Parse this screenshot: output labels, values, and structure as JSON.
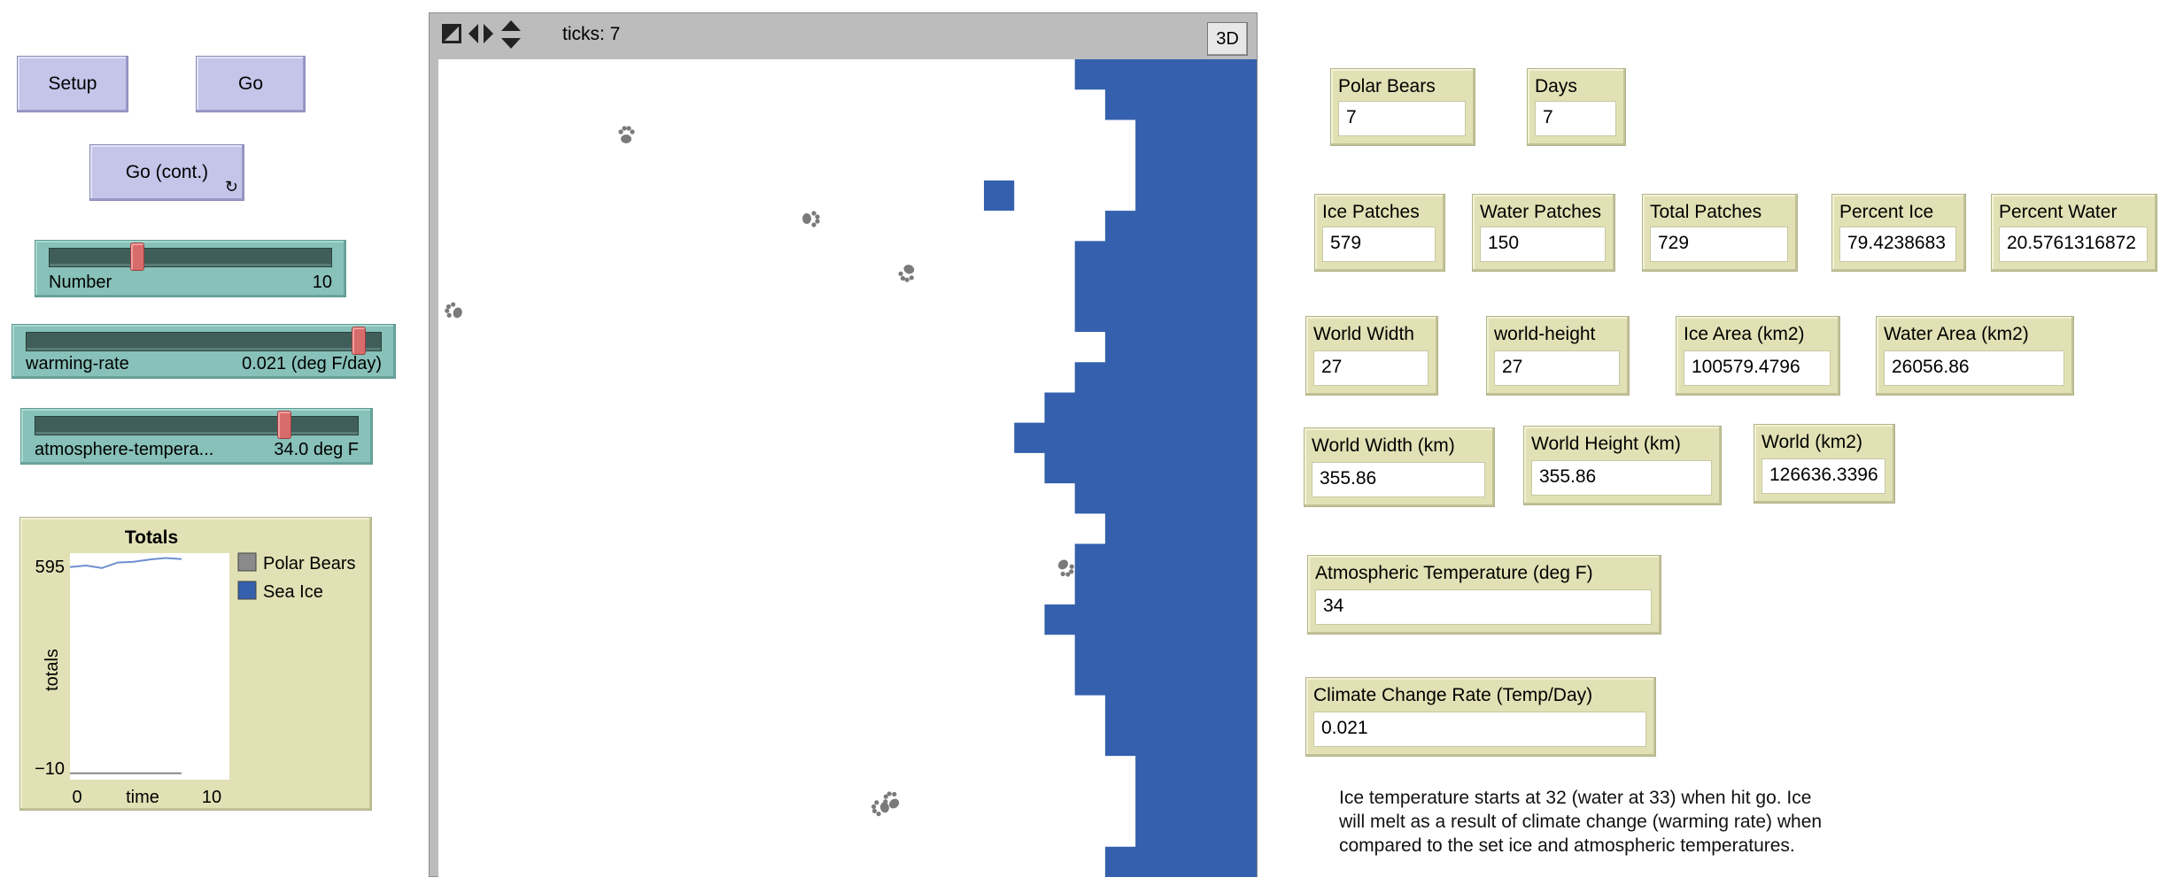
{
  "buttons": {
    "setup": "Setup",
    "go": "Go",
    "go_cont": "Go (cont.)"
  },
  "sliders": {
    "number": {
      "label": "Number",
      "value": "10",
      "fraction": 0.3
    },
    "warming_rate": {
      "label": "warming-rate",
      "value": "0.021 (deg F/day)",
      "fraction": 0.95
    },
    "atmosphere_temperature": {
      "label": "atmosphere-tempera...",
      "value": "34.0 deg F",
      "fraction": 0.78
    }
  },
  "view": {
    "ticks": "ticks: 7",
    "btn_3d": "3D",
    "colors": {
      "ice": "#ffffff",
      "water": "#3460ad",
      "bear": "#7a7a7a",
      "frame": "#bcbcbc"
    }
  },
  "plot": {
    "title": "Totals",
    "ylabel": "totals",
    "xlabel": "time",
    "ymax_label": "595",
    "ymin_label": "−10",
    "xmin_label": "0",
    "xmax_label": "10",
    "legend": [
      {
        "name": "Polar Bears",
        "color": "#8a8a8a"
      },
      {
        "name": "Sea Ice",
        "color": "#3460ad"
      }
    ]
  },
  "chart_data": {
    "type": "line",
    "title": "Totals",
    "xlabel": "time",
    "ylabel": "totals",
    "xlim": [
      0,
      10
    ],
    "ylim": [
      -10,
      595
    ],
    "series": [
      {
        "name": "Polar Bears",
        "color": "#8a8a8a",
        "x": [
          0,
          1,
          2,
          3,
          4,
          5,
          6,
          7
        ],
        "values": [
          7,
          7,
          7,
          7,
          7,
          7,
          7,
          7
        ]
      },
      {
        "name": "Sea Ice",
        "color": "#6f8fd0",
        "x": [
          0,
          1,
          2,
          3,
          4,
          5,
          6,
          7
        ],
        "values": [
          558,
          562,
          555,
          570,
          572,
          578,
          582,
          579
        ]
      }
    ]
  },
  "monitors": {
    "polar_bears": {
      "label": "Polar Bears",
      "value": "7"
    },
    "days": {
      "label": "Days",
      "value": "7"
    },
    "ice_patches": {
      "label": "Ice Patches",
      "value": "579"
    },
    "water_patches": {
      "label": "Water Patches",
      "value": "150"
    },
    "total_patches": {
      "label": "Total Patches",
      "value": "729"
    },
    "percent_ice": {
      "label": "Percent Ice",
      "value": "79.4238683"
    },
    "percent_water": {
      "label": "Percent Water",
      "value": "20.5761316872"
    },
    "world_width": {
      "label": "World Width",
      "value": "27"
    },
    "world_height": {
      "label": "world-height",
      "value": "27"
    },
    "ice_area": {
      "label": "Ice Area  (km2)",
      "value": "100579.4796"
    },
    "water_area": {
      "label": "Water Area (km2)",
      "value": "26056.86"
    },
    "world_width_km": {
      "label": "World Width (km)",
      "value": "355.86"
    },
    "world_height_km": {
      "label": "World Height (km)",
      "value": "355.86"
    },
    "world_km2": {
      "label": "World (km2)",
      "value": "126636.3396"
    },
    "atm_temp": {
      "label": "Atmospheric Temperature (deg F)",
      "value": "34"
    },
    "climate_rate": {
      "label": "Climate Change Rate (Temp/Day)",
      "value": "0.021"
    }
  },
  "note": {
    "line1": "Ice temperature starts at 32 (water at 33) when hit go.  Ice",
    "line2": "will melt as a result of climate change (warming rate) when",
    "line3": "compared to the set ice and atmospheric temperatures."
  }
}
